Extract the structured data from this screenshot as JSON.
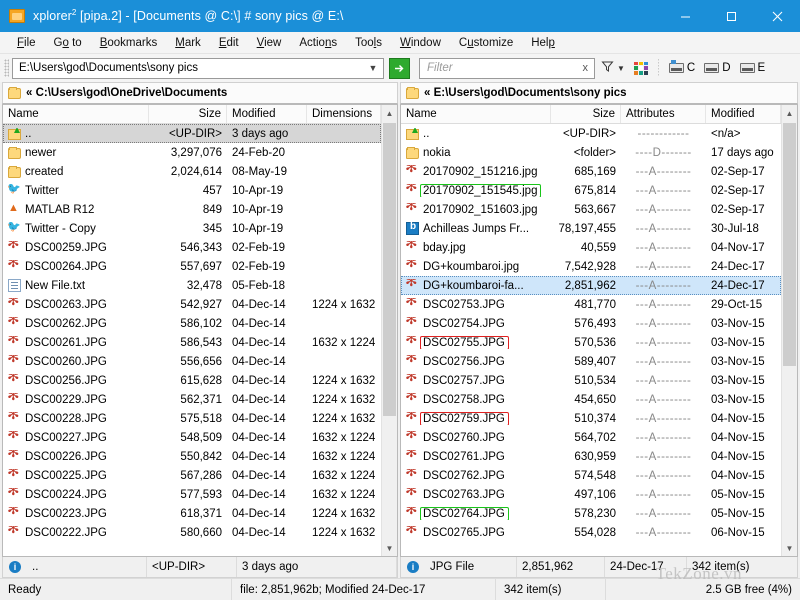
{
  "window": {
    "title_prefix": "xplorer",
    "title_sup": "2",
    "title_rest": " [pipa.2] - [Documents @ C:\\] # sony pics @ E:\\",
    "accent": "#1b8fd8",
    "minimize": "minimize-icon",
    "maximize": "maximize-icon",
    "close": "close-icon"
  },
  "menubar": {
    "items": [
      {
        "pre": "",
        "key": "F",
        "post": "ile"
      },
      {
        "pre": "G",
        "key": "o",
        "post": " to"
      },
      {
        "pre": "",
        "key": "B",
        "post": "ookmarks"
      },
      {
        "pre": "",
        "key": "M",
        "post": "ark"
      },
      {
        "pre": "",
        "key": "E",
        "post": "dit"
      },
      {
        "pre": "",
        "key": "V",
        "post": "iew"
      },
      {
        "pre": "Actio",
        "key": "n",
        "post": "s"
      },
      {
        "pre": "Too",
        "key": "l",
        "post": "s"
      },
      {
        "pre": "",
        "key": "W",
        "post": "indow"
      },
      {
        "pre": "C",
        "key": "u",
        "post": "stomize"
      },
      {
        "pre": "Hel",
        "key": "p",
        "post": ""
      }
    ]
  },
  "toolbar": {
    "path_value": "E:\\Users\\god\\Documents\\sony pics",
    "path_dropdown": "chevron-down-icon",
    "go_label": "➔",
    "filter_placeholder": "Filter",
    "filter_clear": "x",
    "filter_icon": "funnel-icon",
    "filter_dropdown": "▾",
    "color_grid_icon": "color-grid-icon",
    "drives": [
      {
        "label": "C",
        "selected": true
      },
      {
        "label": "D",
        "selected": false
      },
      {
        "label": "E",
        "selected": false
      }
    ]
  },
  "left_pane": {
    "tab_label": "« C:\\Users\\god\\OneDrive\\Documents",
    "columns": [
      "Name",
      "Size",
      "Modified",
      "Dimensions"
    ],
    "rows": [
      {
        "icon": "updir",
        "name": "..",
        "size": "<UP-DIR>",
        "modified": "3 days ago",
        "dim": "",
        "state": "updir"
      },
      {
        "icon": "folder",
        "name": "newer",
        "size": "3,297,076",
        "modified": "24-Feb-20",
        "dim": ""
      },
      {
        "icon": "folder",
        "name": "created",
        "size": "2,024,614",
        "modified": "08-May-19",
        "dim": ""
      },
      {
        "icon": "twitter",
        "name": "Twitter",
        "size": "457",
        "modified": "10-Apr-19",
        "dim": ""
      },
      {
        "icon": "matlab",
        "name": "MATLAB R12",
        "size": "849",
        "modified": "10-Apr-19",
        "dim": ""
      },
      {
        "icon": "twitter",
        "name": "Twitter - Copy",
        "size": "345",
        "modified": "10-Apr-19",
        "dim": ""
      },
      {
        "icon": "jpg",
        "name": "DSC00259.JPG",
        "size": "546,343",
        "modified": "02-Feb-19",
        "dim": ""
      },
      {
        "icon": "jpg",
        "name": "DSC00264.JPG",
        "size": "557,697",
        "modified": "02-Feb-19",
        "dim": ""
      },
      {
        "icon": "txt",
        "name": "New File.txt",
        "size": "32,478",
        "modified": "05-Feb-18",
        "dim": ""
      },
      {
        "icon": "jpg",
        "name": "DSC00263.JPG",
        "size": "542,927",
        "modified": "04-Dec-14",
        "dim": "1224 x 1632"
      },
      {
        "icon": "jpg",
        "name": "DSC00262.JPG",
        "size": "586,102",
        "modified": "04-Dec-14",
        "dim": ""
      },
      {
        "icon": "jpg",
        "name": "DSC00261.JPG",
        "size": "586,543",
        "modified": "04-Dec-14",
        "dim": "1632 x 1224"
      },
      {
        "icon": "jpg",
        "name": "DSC00260.JPG",
        "size": "556,656",
        "modified": "04-Dec-14",
        "dim": ""
      },
      {
        "icon": "jpg",
        "name": "DSC00256.JPG",
        "size": "615,628",
        "modified": "04-Dec-14",
        "dim": "1224 x 1632"
      },
      {
        "icon": "jpg",
        "name": "DSC00229.JPG",
        "size": "562,371",
        "modified": "04-Dec-14",
        "dim": "1224 x 1632"
      },
      {
        "icon": "jpg",
        "name": "DSC00228.JPG",
        "size": "575,518",
        "modified": "04-Dec-14",
        "dim": "1224 x 1632"
      },
      {
        "icon": "jpg",
        "name": "DSC00227.JPG",
        "size": "548,509",
        "modified": "04-Dec-14",
        "dim": "1632 x 1224"
      },
      {
        "icon": "jpg",
        "name": "DSC00226.JPG",
        "size": "550,842",
        "modified": "04-Dec-14",
        "dim": "1632 x 1224"
      },
      {
        "icon": "jpg",
        "name": "DSC00225.JPG",
        "size": "567,286",
        "modified": "04-Dec-14",
        "dim": "1632 x 1224"
      },
      {
        "icon": "jpg",
        "name": "DSC00224.JPG",
        "size": "577,593",
        "modified": "04-Dec-14",
        "dim": "1632 x 1224"
      },
      {
        "icon": "jpg",
        "name": "DSC00223.JPG",
        "size": "618,371",
        "modified": "04-Dec-14",
        "dim": "1224 x 1632"
      },
      {
        "icon": "jpg",
        "name": "DSC00222.JPG",
        "size": "580,660",
        "modified": "04-Dec-14",
        "dim": "1224 x 1632"
      }
    ],
    "status": {
      "name": "..",
      "size": "<UP-DIR>",
      "modified": "3 days ago"
    }
  },
  "right_pane": {
    "tab_label": "« E:\\Users\\god\\Documents\\sony pics",
    "columns": [
      "Name",
      "Size",
      "Attributes",
      "Modified"
    ],
    "rows": [
      {
        "icon": "updir",
        "name": "..",
        "size": "<UP-DIR>",
        "attr": "------------",
        "modified": "<n/a>"
      },
      {
        "icon": "folder",
        "name": "nokia",
        "size": "<folder>",
        "attr": "----D-------",
        "modified": "17 days ago"
      },
      {
        "icon": "jpg",
        "name": "20170902_151216.jpg",
        "size": "685,169",
        "attr": "---A--------",
        "modified": "02-Sep-17"
      },
      {
        "icon": "jpg",
        "name": "20170902_151545.jpg",
        "size": "675,814",
        "attr": "---A--------",
        "modified": "02-Sep-17",
        "box": "green"
      },
      {
        "icon": "jpg",
        "name": "20170902_151603.jpg",
        "size": "563,667",
        "attr": "---A--------",
        "modified": "02-Sep-17"
      },
      {
        "icon": "office",
        "name": "Achilleas Jumps Fr...",
        "size": "78,197,455",
        "attr": "---A--------",
        "modified": "30-Jul-18"
      },
      {
        "icon": "jpg",
        "name": "bday.jpg",
        "size": "40,559",
        "attr": "---A--------",
        "modified": "04-Nov-17"
      },
      {
        "icon": "jpg",
        "name": "DG+koumbaroi.jpg",
        "size": "7,542,928",
        "attr": "---A--------",
        "modified": "24-Dec-17"
      },
      {
        "icon": "jpg",
        "name": "DG+koumbaroi-fa...",
        "size": "2,851,962",
        "attr": "---A--------",
        "modified": "24-Dec-17",
        "state": "selected"
      },
      {
        "icon": "jpg",
        "name": "DSC02753.JPG",
        "size": "481,770",
        "attr": "---A--------",
        "modified": "29-Oct-15"
      },
      {
        "icon": "jpg",
        "name": "DSC02754.JPG",
        "size": "576,493",
        "attr": "---A--------",
        "modified": "03-Nov-15"
      },
      {
        "icon": "jpg",
        "name": "DSC02755.JPG",
        "size": "570,536",
        "attr": "---A--------",
        "modified": "03-Nov-15",
        "box": "red"
      },
      {
        "icon": "jpg",
        "name": "DSC02756.JPG",
        "size": "589,407",
        "attr": "---A--------",
        "modified": "03-Nov-15"
      },
      {
        "icon": "jpg",
        "name": "DSC02757.JPG",
        "size": "510,534",
        "attr": "---A--------",
        "modified": "03-Nov-15"
      },
      {
        "icon": "jpg",
        "name": "DSC02758.JPG",
        "size": "454,650",
        "attr": "---A--------",
        "modified": "03-Nov-15"
      },
      {
        "icon": "jpg",
        "name": "DSC02759.JPG",
        "size": "510,374",
        "attr": "---A--------",
        "modified": "04-Nov-15",
        "box": "red"
      },
      {
        "icon": "jpg",
        "name": "DSC02760.JPG",
        "size": "564,702",
        "attr": "---A--------",
        "modified": "04-Nov-15"
      },
      {
        "icon": "jpg",
        "name": "DSC02761.JPG",
        "size": "630,959",
        "attr": "---A--------",
        "modified": "04-Nov-15"
      },
      {
        "icon": "jpg",
        "name": "DSC02762.JPG",
        "size": "574,548",
        "attr": "---A--------",
        "modified": "04-Nov-15"
      },
      {
        "icon": "jpg",
        "name": "DSC02763.JPG",
        "size": "497,106",
        "attr": "---A--------",
        "modified": "05-Nov-15"
      },
      {
        "icon": "jpg",
        "name": "DSC02764.JPG",
        "size": "578,230",
        "attr": "---A--------",
        "modified": "05-Nov-15",
        "box": "green"
      },
      {
        "icon": "jpg",
        "name": "DSC02765.JPG",
        "size": "554,028",
        "attr": "---A--------",
        "modified": "06-Nov-15"
      }
    ],
    "status": {
      "type": "JPG File",
      "size": "2,851,962",
      "modified": "24-Dec-17",
      "count": "342 item(s)"
    }
  },
  "statusbar": {
    "ready": "Ready",
    "file_info": "file: 2,851,962b; Modified 24-Dec-17",
    "items": "342 item(s)",
    "free": "2.5 GB free (4%)"
  },
  "watermark": "TekZone.vn",
  "colors": {
    "title_bg": "#1b8fd8",
    "selection": "#cfe6fa",
    "box_red": "#e02020",
    "box_green": "#19c419",
    "jpg_icon": "#c0392b",
    "go_green": "#2eaa2e"
  }
}
